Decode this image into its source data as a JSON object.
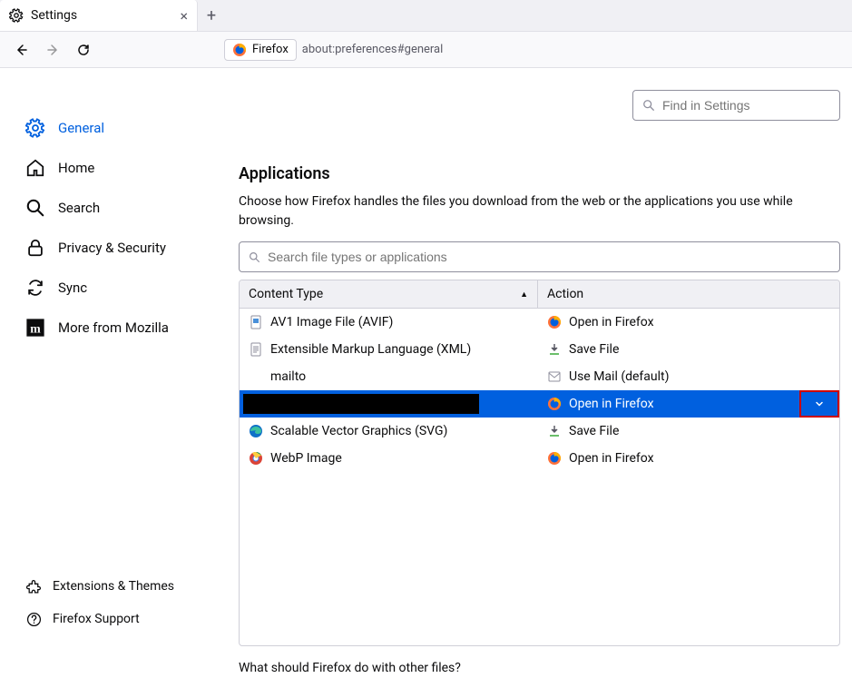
{
  "tab": {
    "title": "Settings"
  },
  "identity": {
    "label": "Firefox"
  },
  "url": "about:preferences#general",
  "sidebar": {
    "items": [
      {
        "label": "General"
      },
      {
        "label": "Home"
      },
      {
        "label": "Search"
      },
      {
        "label": "Privacy & Security"
      },
      {
        "label": "Sync"
      },
      {
        "label": "More from Mozilla"
      }
    ],
    "footer": [
      {
        "label": "Extensions & Themes"
      },
      {
        "label": "Firefox Support"
      }
    ]
  },
  "search": {
    "placeholder": "Find in Settings"
  },
  "section": {
    "title": "Applications",
    "description": "Choose how Firefox handles the files you download from the web or the applications you use while browsing.",
    "app_search_placeholder": "Search file types or applications",
    "col_type": "Content Type",
    "col_action": "Action",
    "rows": [
      {
        "type": "AV1 Image File (AVIF)",
        "action": "Open in Firefox"
      },
      {
        "type": "Extensible Markup Language (XML)",
        "action": "Save File"
      },
      {
        "type": "mailto",
        "action": "Use Mail (default)"
      },
      {
        "type": "",
        "action": "Open in Firefox"
      },
      {
        "type": "Scalable Vector Graphics (SVG)",
        "action": "Save File"
      },
      {
        "type": "WebP Image",
        "action": "Open in Firefox"
      }
    ],
    "footer_q": "What should Firefox do with other files?"
  }
}
